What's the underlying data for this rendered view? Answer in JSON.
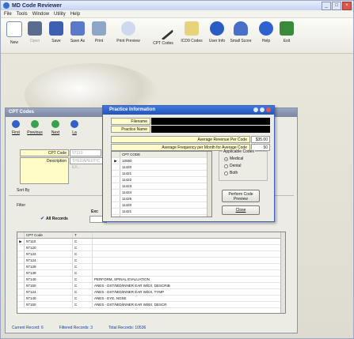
{
  "window": {
    "title": "MD Code Reviewer",
    "min": "_",
    "max": "□",
    "close": "×"
  },
  "menu": [
    "File",
    "Tools",
    "Window",
    "Utility",
    "Help"
  ],
  "toolbar": [
    "New",
    "Open",
    "Save",
    "Save As",
    "Print",
    "Print Preview",
    "CPT Codes",
    "ICD9 Codes",
    "User Info",
    "Small Score",
    "Help",
    "Exit"
  ],
  "colors": {
    "title_accent": "#2454b8",
    "highlight_field": "#fffcc8",
    "status_text": "#1b3d9a"
  },
  "cpt": {
    "title": "CPT Codes",
    "nav": [
      "First",
      "Previous",
      "Next",
      "La"
    ],
    "cpt_code_label": "CPT Code",
    "cpt_code_value": "97110",
    "description_label": "Description",
    "description_value": "THERAPEUTIC EX...",
    "sort_by": "Sort By",
    "filter": "Filter",
    "all_records": "All Records",
    "exclude": "Exc",
    "grid_headers": {
      "code": "CPT Code",
      "type": "T",
      "desc": ""
    },
    "rows": [
      {
        "code": "97110",
        "type": "C",
        "desc": ""
      },
      {
        "code": "97120",
        "type": "C",
        "desc": ""
      },
      {
        "code": "97122",
        "type": "C",
        "desc": ""
      },
      {
        "code": "97124",
        "type": "C",
        "desc": ""
      },
      {
        "code": "97129",
        "type": "C",
        "desc": ""
      },
      {
        "code": "97139",
        "type": "C",
        "desc": ""
      },
      {
        "code": "97140",
        "type": "C",
        "desc": "PERFORM, SPINAL EVALUATION"
      },
      {
        "code": "97150",
        "type": "C",
        "desc": "ANES - DXT/MID/INNER EAR W/EX, DESCRIB"
      },
      {
        "code": "97124",
        "type": "C",
        "desc": "ANES - DXT/MID/INNER EAR W/EX, TYMP"
      },
      {
        "code": "97140",
        "type": "C",
        "desc": "ANES - EYE, NOSE"
      },
      {
        "code": "97150",
        "type": "C",
        "desc": "ANES - DXT/MID/INNER EAR W/BX, DESCR"
      }
    ],
    "status": {
      "current": "Current Record: 6",
      "filtered": "Filtered Records: 3",
      "total": "Total Records: 10536"
    }
  },
  "practice": {
    "title": "Practice Information",
    "filename_label": "Filename",
    "practice_name_label": "Practice Name",
    "avg_rev_label": "Average Revenue Per Code",
    "avg_rev_value": "$35.00",
    "avg_freq_label": "Average Frequency per Month for Average Code",
    "avg_freq_value": "50",
    "code_list_header": "CPT CODE",
    "code_list": [
      "10060",
      "11420",
      "11421",
      "11422",
      "11423",
      "11424",
      "11426",
      "11420",
      "11421",
      "11422",
      "11423",
      "11424"
    ],
    "applicable": "Applicable Codes",
    "medical": "Medical",
    "dental": "Dental",
    "both": "Both",
    "perform": "Perform Code Preview",
    "close": "Close"
  }
}
